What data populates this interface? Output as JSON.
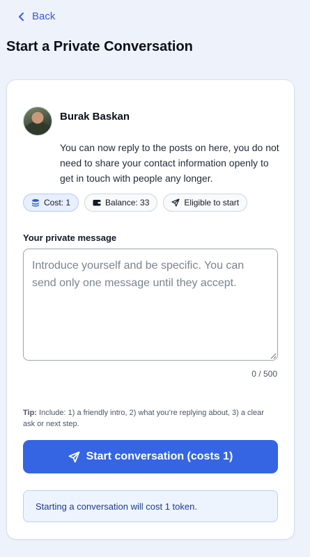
{
  "nav": {
    "back_label": "Back"
  },
  "page": {
    "title": "Start a Private Conversation"
  },
  "recipient": {
    "name": "Burak Baskan",
    "description": "You can now reply to the posts on here, you do not need to share your contact information openly to get in touch with people any longer."
  },
  "chips": {
    "cost": "Cost: 1",
    "balance": "Balance: 33",
    "eligible": "Eligible to start"
  },
  "message": {
    "label": "Your private message",
    "value": "",
    "placeholder": "Introduce yourself and be specific. You can send only one message until they accept.",
    "counter": "0 / 500"
  },
  "tip": {
    "prefix": "Tip:",
    "text": " Include: 1) a friendly intro, 2) what you’re replying about, 3) a clear ask or next step."
  },
  "actions": {
    "start_label": "Start conversation (costs 1)"
  },
  "notice": {
    "text": "Starting a conversation will cost 1 token."
  },
  "colors": {
    "accent": "#3565e3",
    "link": "#3b5bdb",
    "background": "#eef2fb",
    "notice_bg": "#eef4fd"
  },
  "icons": {
    "back": "chevron-left-icon",
    "cost": "coins-icon",
    "balance": "wallet-icon",
    "eligible": "send-icon",
    "start": "send-icon"
  }
}
